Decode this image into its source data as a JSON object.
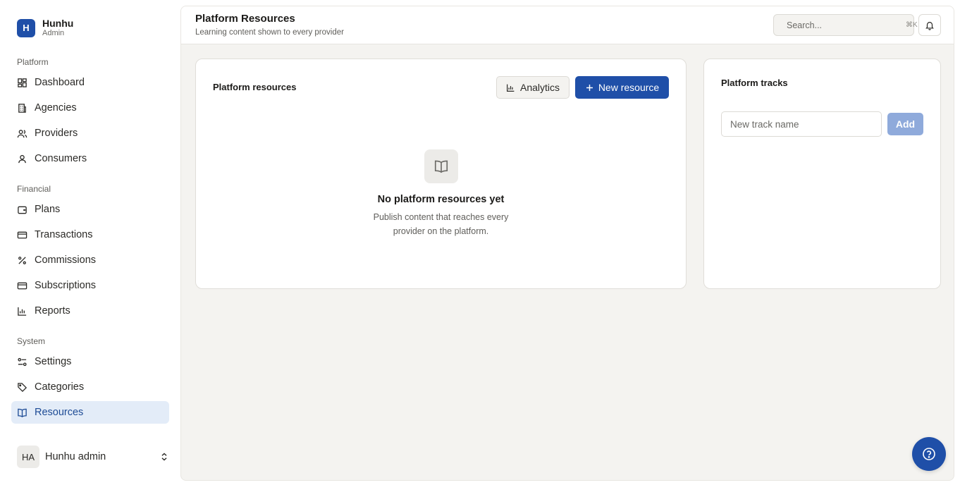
{
  "brand": {
    "initial": "H",
    "name": "Hunhu",
    "role": "Admin"
  },
  "sidebar": {
    "sections": [
      {
        "heading": "Platform",
        "items": [
          "Dashboard",
          "Agencies",
          "Providers",
          "Consumers"
        ]
      },
      {
        "heading": "Financial",
        "items": [
          "Plans",
          "Transactions",
          "Commissions",
          "Subscriptions",
          "Reports"
        ]
      },
      {
        "heading": "System",
        "items": [
          "Settings",
          "Categories",
          "Resources"
        ]
      }
    ],
    "active_item": "Resources"
  },
  "user": {
    "initials": "HA",
    "name": "Hunhu admin"
  },
  "header": {
    "title": "Platform Resources",
    "subtitle": "Learning content shown to every provider",
    "search_placeholder": "Search...",
    "search_shortcut": "⌘K"
  },
  "resources_card": {
    "title": "Platform resources",
    "analytics_label": "Analytics",
    "new_label": "New resource",
    "empty_title": "No platform resources yet",
    "empty_desc": "Publish content that reaches every provider on the platform."
  },
  "tracks_card": {
    "title": "Platform tracks",
    "input_placeholder": "New track name",
    "add_label": "Add"
  },
  "colors": {
    "accent": "#1f4fa8",
    "active_bg": "#e3ecf8",
    "canvas": "#f4f3f0"
  }
}
